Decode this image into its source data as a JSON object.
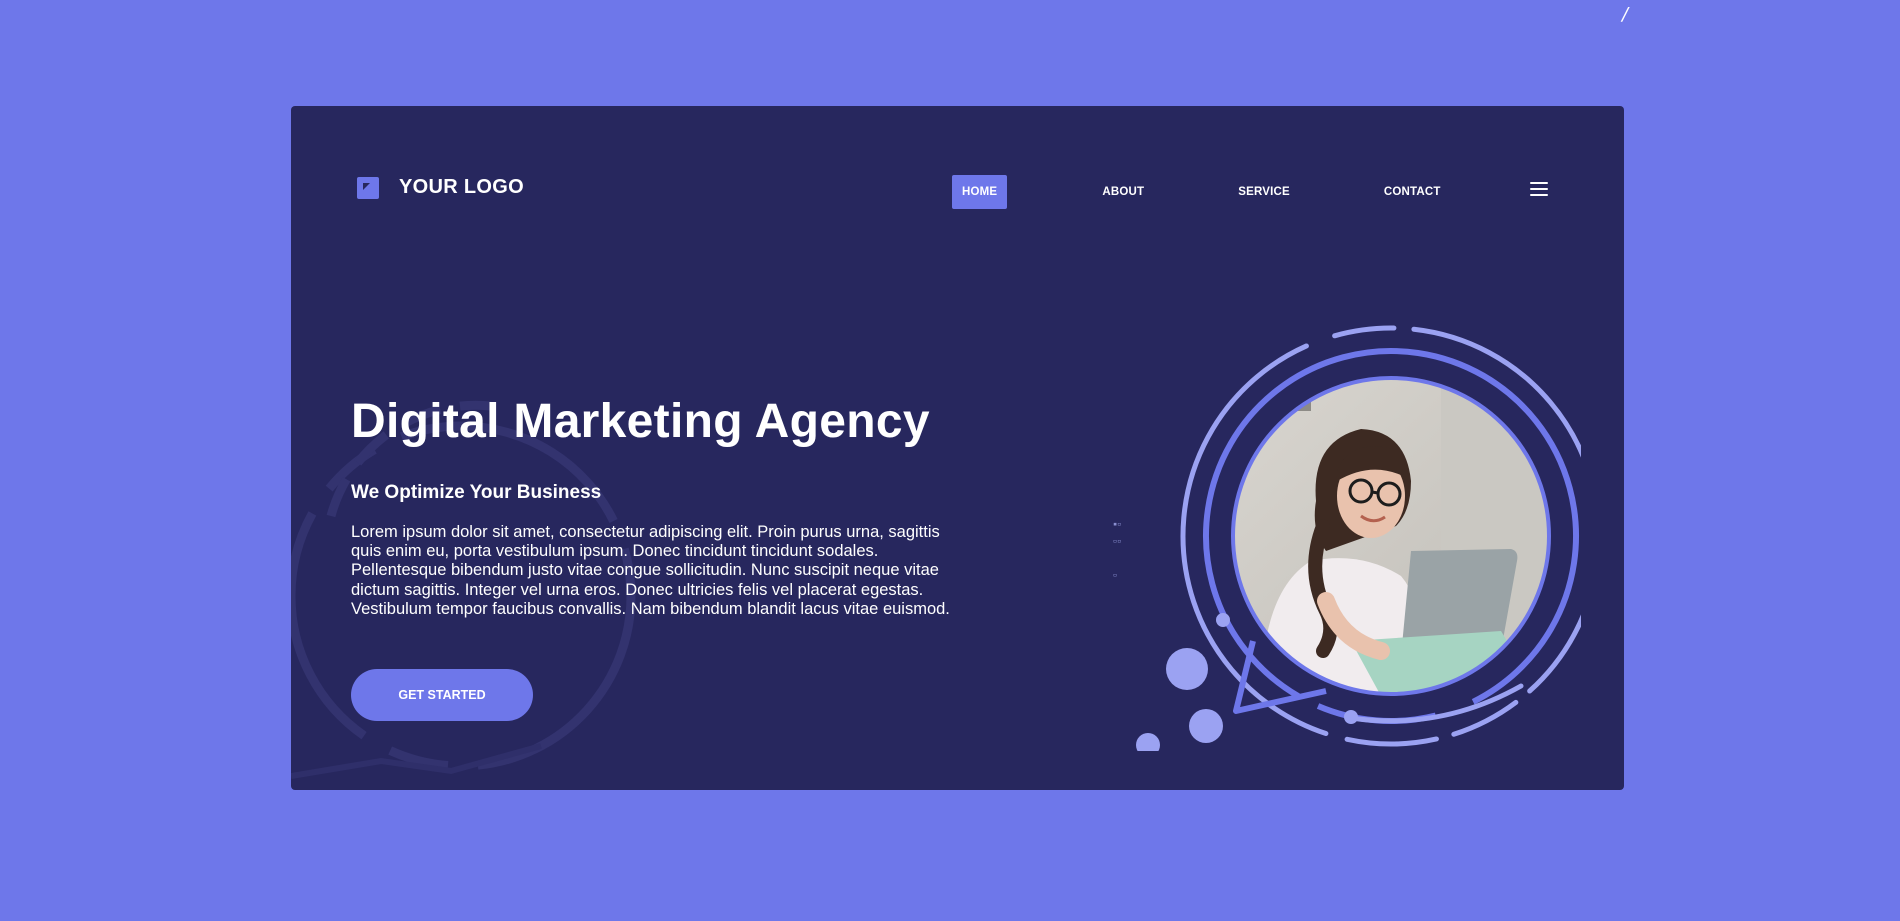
{
  "page": {
    "corner_mark": "/"
  },
  "colors": {
    "background": "#6e77ea",
    "card": "#27275e",
    "accent": "#6e77ea",
    "ring_light": "#9ba2f2",
    "text": "#ffffff"
  },
  "header": {
    "logo_icon": "square-arrow-icon",
    "logo_text": "YOUR LOGO",
    "nav": [
      {
        "label": "HOME",
        "active": true
      },
      {
        "label": "ABOUT",
        "active": false
      },
      {
        "label": "SERVICE",
        "active": false
      },
      {
        "label": "CONTACT",
        "active": false
      }
    ],
    "menu_icon": "hamburger-menu-icon"
  },
  "hero": {
    "title": "Digital Marketing Agency",
    "subtitle": "We Optimize Your Business",
    "body": "Lorem ipsum dolor sit amet, consectetur adipiscing elit. Proin purus urna, sagittis quis enim eu, porta vestibulum ipsum. Donec tincidunt tincidunt sodales. Pellentesque bibendum justo vitae congue sollicitudin. Nunc suscipit neque vitae dictum sagittis. Integer vel urna eros. Donec ultricies felis vel placerat egestas. Vestibulum tempor faucibus convallis. Nam bibendum blandit lacus vitae euismod.",
    "cta_label": "GET STARTED"
  }
}
